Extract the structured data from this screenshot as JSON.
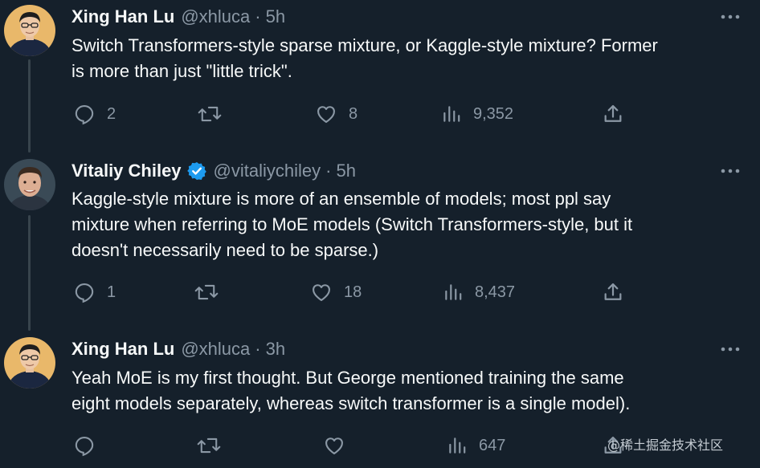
{
  "tweets": [
    {
      "name": "Xing Han Lu",
      "verified": false,
      "handle": "@xhluca",
      "separator": "·",
      "time": "5h",
      "text_lines": [
        "Switch Transformers-style sparse mixture, or Kaggle-style mixture? Former",
        "is more than just \"little trick\"."
      ],
      "replies": "2",
      "retweets": "",
      "likes": "8",
      "views": "9,352"
    },
    {
      "name": "Vitaliy Chiley",
      "verified": true,
      "handle": "@vitaliychiley",
      "separator": "·",
      "time": "5h",
      "text_lines": [
        "Kaggle-style mixture is more of an ensemble of models; most ppl say",
        "mixture when referring to MoE models (Switch Transformers-style, but it",
        "doesn't necessarily need to be sparse.)"
      ],
      "replies": "1",
      "retweets": "",
      "likes": "18",
      "views": "8,437"
    },
    {
      "name": "Xing Han Lu",
      "verified": false,
      "handle": "@xhluca",
      "separator": "·",
      "time": "3h",
      "text_lines": [
        "Yeah MoE is my first thought. But George mentioned training the same",
        "eight models separately, whereas switch transformer is a single model)."
      ],
      "replies": "",
      "retweets": "",
      "likes": "",
      "views": "647"
    }
  ],
  "icons": {
    "reply": "reply-icon",
    "retweet": "retweet-icon",
    "like": "like-icon",
    "views": "views-icon",
    "share": "share-icon",
    "more": "more-icon",
    "verified": "verified-badge-icon"
  },
  "colors": {
    "background": "#15202b",
    "text": "#f7f9f9",
    "secondary": "#8b98a5",
    "verified": "#1d9bf0",
    "thread_line": "#38444d"
  },
  "watermark": "@稀土掘金技术社区"
}
